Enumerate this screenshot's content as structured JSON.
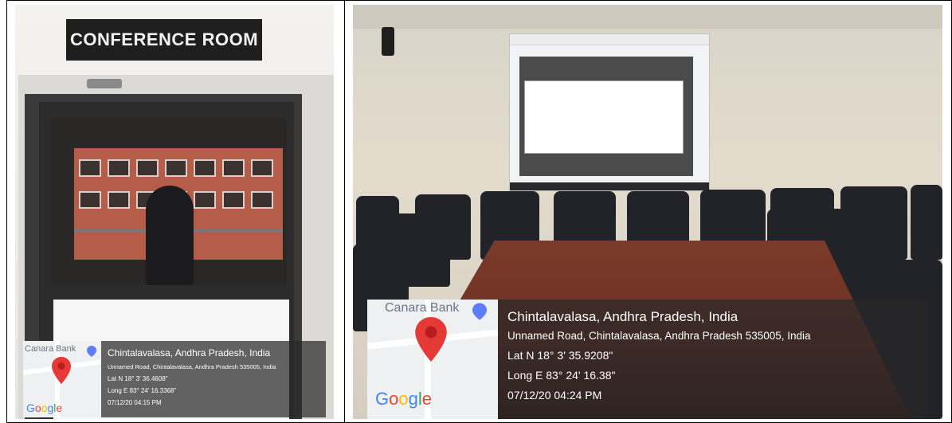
{
  "left_photo": {
    "sign_text": "CONFERENCE ROOM",
    "geotag": {
      "map_label": "Canara Bank",
      "map_logo": "Google",
      "place": "Chintalavalasa, Andhra Pradesh, India",
      "address": "Unnamed Road, Chintalavalasa, Andhra Pradesh 535005, India",
      "lat": "Lat N 18° 3' 36.4608\"",
      "long": "Long E 83° 24' 16.3368\"",
      "datetime": "07/12/20 04:15 PM"
    }
  },
  "right_photo": {
    "geotag": {
      "map_label": "Canara Bank",
      "map_logo": "Google",
      "place": "Chintalavalasa, Andhra Pradesh, India",
      "address": "Unnamed Road, Chintalavalasa, Andhra Pradesh 535005, India",
      "lat": "Lat N 18° 3' 35.9208\"",
      "long": "Long E 83° 24' 16.38\"",
      "datetime": "07/12/20 04:24 PM"
    }
  },
  "colors": {
    "pin": "#e53935",
    "overlay": "#282828"
  },
  "icons": [
    "map-pin-icon",
    "bank-marker-icon"
  ]
}
